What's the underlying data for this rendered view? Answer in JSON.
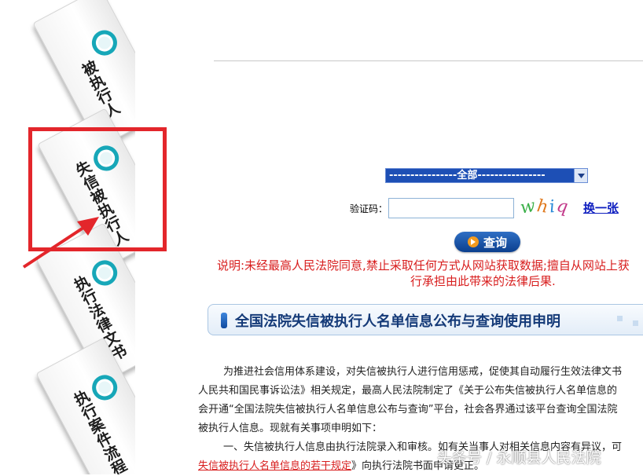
{
  "sidebar": {
    "tabs": [
      {
        "label": "被执行人"
      },
      {
        "label": "失信被执行人"
      },
      {
        "label": "执行法律文书"
      },
      {
        "label": "执行案件流程"
      }
    ]
  },
  "search": {
    "scope_selected": "----------------全部----------------",
    "captcha_label": "验证码：",
    "captcha_value": "",
    "captcha_chars": [
      "w",
      "h",
      "i",
      "q"
    ],
    "refresh_label": "换一张",
    "query_label": "查询"
  },
  "notice": {
    "line1": "说明:未经最高人民法院同意,禁止采取任何方式从网站获取数据;擅自从网站上获",
    "line2": "行承担由此带来的法律后果."
  },
  "declaration": {
    "title": "全国法院失信被执行人名单信息公布与查询使用申明",
    "para1_l1": "为推进社会信用体系建设，对失信被执行人进行信用惩戒，促使其自动履行生效法律文书",
    "para1_l2": "人民共和国民事诉讼法》相关规定，最高人民法院制定了《关于公布失信被执行人名单信息的",
    "para1_l3": "会开通“全国法院失信被执行人名单信息公布与查询”平台，社会各界通过该平台查询全国法院",
    "para1_l4": "被执行人信息。现就有关事项申明如下：",
    "para2_l1": "一、失信被执行人信息由执行法院录入和审核。如有关当事人对相关信息内容有异议，可",
    "para2_link": "失信被执行人名单信息的若干规定",
    "para2_l2_suffix": "》向执行法院书面申请更正。"
  },
  "watermark": "头条号 / 永顺县人民法院",
  "colors": {
    "highlight_red": "#e3262b",
    "notice_red": "#d81e1e",
    "select_blue": "#1d4fb5",
    "tab_ring_teal": "#17a7b8",
    "link_blue": "#1020c0"
  }
}
